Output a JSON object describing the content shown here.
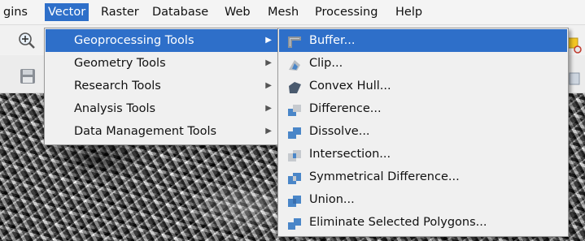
{
  "menubar": {
    "items": [
      {
        "label": "gins"
      },
      {
        "label": "Vector"
      },
      {
        "label": "Raster"
      },
      {
        "label": "Database"
      },
      {
        "label": "Web"
      },
      {
        "label": "Mesh"
      },
      {
        "label": "Processing"
      },
      {
        "label": "Help"
      }
    ]
  },
  "vector_menu": {
    "items": [
      {
        "label": "Geoprocessing Tools",
        "submenu": "▶"
      },
      {
        "label": "Geometry Tools",
        "submenu": "▶"
      },
      {
        "label": "Research Tools",
        "submenu": "▶"
      },
      {
        "label": "Analysis Tools",
        "submenu": "▶"
      },
      {
        "label": "Data Management Tools",
        "submenu": "▶"
      }
    ]
  },
  "geoprocessing_menu": {
    "items": [
      {
        "label": "Buffer...",
        "icon": "buffer-icon"
      },
      {
        "label": "Clip...",
        "icon": "clip-icon"
      },
      {
        "label": "Convex Hull...",
        "icon": "convex-hull-icon"
      },
      {
        "label": "Difference...",
        "icon": "difference-icon"
      },
      {
        "label": "Dissolve...",
        "icon": "dissolve-icon"
      },
      {
        "label": "Intersection...",
        "icon": "intersection-icon"
      },
      {
        "label": "Symmetrical Difference...",
        "icon": "symmetrical-difference-icon"
      },
      {
        "label": "Union...",
        "icon": "union-icon"
      },
      {
        "label": "Eliminate Selected Polygons...",
        "icon": "eliminate-polygons-icon"
      }
    ]
  },
  "colors": {
    "highlight": "#2e6fc9",
    "menu_bg": "#f0f0f0",
    "icon_blue": "#4a86c8",
    "icon_gray": "#9aa0a6"
  }
}
